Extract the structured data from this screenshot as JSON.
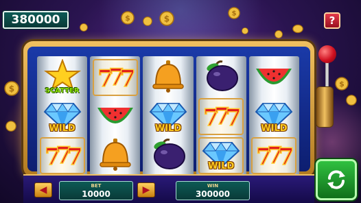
{
  "balance": {
    "amount": "380000"
  },
  "help": {
    "label": "?"
  },
  "reels": [
    [
      {
        "symbol": "star",
        "label": "SCATTER",
        "boxed": false
      },
      {
        "symbol": "diamond",
        "label": "WILD",
        "boxed": false
      },
      {
        "symbol": "sevens",
        "label": "",
        "boxed": true
      }
    ],
    [
      {
        "symbol": "sevens",
        "label": "",
        "boxed": true
      },
      {
        "symbol": "watermelon",
        "label": "",
        "boxed": false
      },
      {
        "symbol": "bell",
        "label": "",
        "boxed": false
      }
    ],
    [
      {
        "symbol": "bell",
        "label": "",
        "boxed": false
      },
      {
        "symbol": "diamond",
        "label": "WILD",
        "boxed": false
      },
      {
        "symbol": "plum",
        "label": "",
        "boxed": false
      }
    ],
    [
      {
        "symbol": "plum",
        "label": "",
        "boxed": false
      },
      {
        "symbol": "sevens",
        "label": "",
        "boxed": true
      },
      {
        "symbol": "diamond",
        "label": "WILD",
        "boxed": true
      }
    ],
    [
      {
        "symbol": "watermelon",
        "label": "",
        "boxed": false
      },
      {
        "symbol": "diamond",
        "label": "WILD",
        "boxed": false
      },
      {
        "symbol": "sevens",
        "label": "",
        "boxed": true
      }
    ]
  ],
  "bet": {
    "label": "BET",
    "value": "10000"
  },
  "win": {
    "label": "WIN",
    "value": "300000"
  },
  "controls": {
    "decrease": "◀",
    "increase": "▶"
  },
  "colors": {
    "accent_gold": "#f0c060",
    "panel_teal": "#0d5a55",
    "spin_green": "#30c040",
    "help_red": "#e23a4a"
  }
}
